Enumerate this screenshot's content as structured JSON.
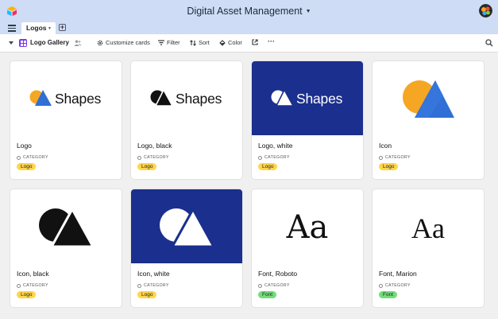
{
  "app": {
    "title": "Digital Asset Management"
  },
  "tabs": [
    {
      "label": "Logos"
    }
  ],
  "toolbar": {
    "view_name": "Logo Gallery",
    "customize": "Customize cards",
    "filter": "Filter",
    "sort": "Sort",
    "color": "Color"
  },
  "field_label": "CATEGORY",
  "cards": [
    {
      "title": "Logo",
      "category": "Logo",
      "wordmark": "Shapes"
    },
    {
      "title": "Logo, black",
      "category": "Logo",
      "wordmark": "Shapes"
    },
    {
      "title": "Logo, white",
      "category": "Logo",
      "wordmark": "Shapes"
    },
    {
      "title": "Icon",
      "category": "Logo"
    },
    {
      "title": "Icon, black",
      "category": "Logo"
    },
    {
      "title": "Icon, white",
      "category": "Logo"
    },
    {
      "title": "Font, Roboto",
      "category": "Font",
      "sample": "Aa"
    },
    {
      "title": "Font, Marion",
      "category": "Font",
      "sample": "Aa"
    }
  ],
  "colors": {
    "header_bg": "#cedcf5",
    "card_blue": "#1b2f8e",
    "logo_tag": "#ffd54a",
    "font_tag": "#72dd7a",
    "view_icon": "#7c39ed"
  }
}
